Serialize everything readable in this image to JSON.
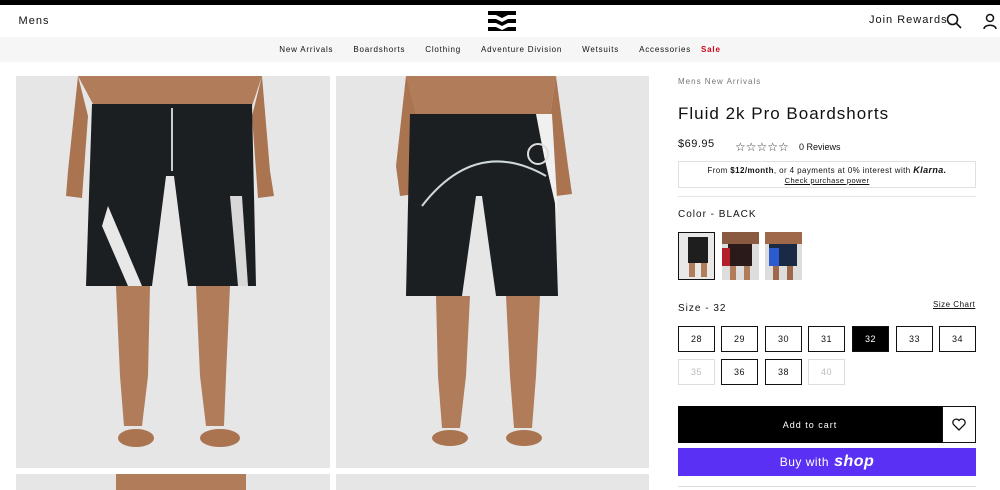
{
  "header": {
    "mens_tab": "Mens",
    "join_rewards": "Join Rewards",
    "logo_icon": "billabong-logo-icon",
    "search_icon": "search-icon",
    "user_icon": "user-icon"
  },
  "nav": {
    "items": [
      "New Arrivals",
      "Boardshorts",
      "Clothing",
      "Adventure Division",
      "Wetsuits",
      "Accessories"
    ],
    "sale": "Sale"
  },
  "product": {
    "breadcrumb": "Mens New Arrivals",
    "title": "Fluid 2k Pro Boardshorts",
    "price": "$69.95",
    "rating": 0,
    "stars": "☆☆☆☆☆",
    "reviews": "0 Reviews",
    "klarna": {
      "from": "From",
      "amount": "$12/month",
      "rest": ", or 4 payments at 0% interest with",
      "brand": "Klarna.",
      "check": "Check purchase power"
    },
    "color_label": "Color - BLACK",
    "colors": [
      "black",
      "red",
      "blue"
    ],
    "size_label": "Size - 32",
    "size_chart": "Size Chart",
    "sizes": [
      "28",
      "29",
      "30",
      "31",
      "32",
      "33",
      "34",
      "35",
      "36",
      "38",
      "40"
    ],
    "selected_size": "32",
    "unavailable_sizes": [
      "35",
      "40"
    ],
    "add_to_cart": "Add to cart",
    "buy_with": "Buy with",
    "shop": "shop"
  },
  "colors": {
    "accent": "#000000",
    "sale": "#d0021b",
    "shop_pay": "#5a31f4"
  }
}
